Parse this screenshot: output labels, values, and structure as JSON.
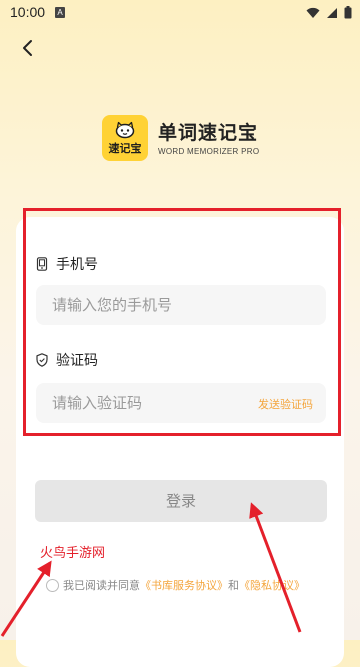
{
  "status_bar": {
    "time": "10:00",
    "notification_letter": "A"
  },
  "header": {
    "back_icon": "chevron-left-icon"
  },
  "brand": {
    "logo_text": "速记宝",
    "title": "单词速记宝",
    "subtitle": "WORD MEMORIZER PRO",
    "logo_color": "#ffd235"
  },
  "form": {
    "phone": {
      "label": "手机号",
      "placeholder": "请输入您的手机号",
      "icon": "phone-icon"
    },
    "code": {
      "label": "验证码",
      "placeholder": "请输入验证码",
      "icon": "shield-icon",
      "send_label": "发送验证码"
    },
    "login_label": "登录"
  },
  "agreement": {
    "prefix": "我已阅读并同意",
    "service_link": "《书库服务协议》",
    "conjunction": "和",
    "privacy_link": "《隐私协议》"
  },
  "watermark": "火鸟手游网",
  "colors": {
    "accent": "#f4a53c",
    "annotation_red": "#e4202b"
  }
}
